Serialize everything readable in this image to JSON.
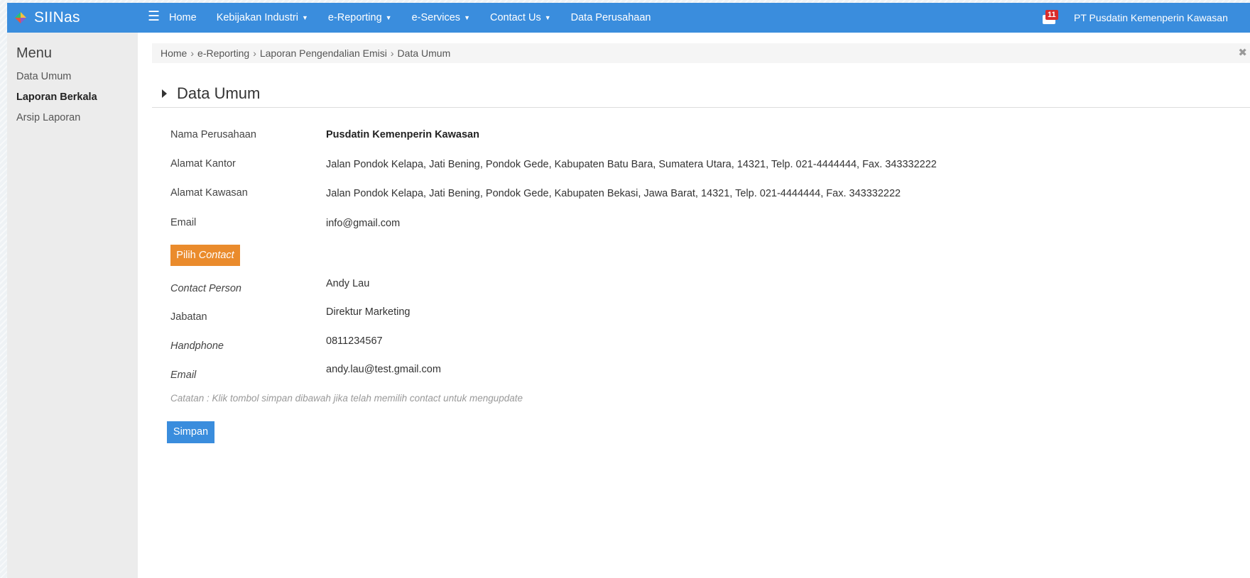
{
  "app": {
    "name": "SIINas",
    "logo_icon": "diamond-logo-icon"
  },
  "colors": {
    "primary": "#3a8ddd",
    "accent": "#ea8b2c",
    "badge": "#d92b2b"
  },
  "nav": {
    "home": "Home",
    "kebijakan": "Kebijakan Industri",
    "ereporting": "e-Reporting",
    "eservices": "e-Services",
    "contact": "Contact Us",
    "data_perusahaan": "Data Perusahaan"
  },
  "notifications": {
    "count": "11",
    "icon": "mail-icon"
  },
  "user": {
    "company": "PT Pusdatin Kemenperin Kawasan"
  },
  "sidebar": {
    "title": "Menu",
    "items": [
      {
        "label": "Data Umum"
      },
      {
        "label": "Laporan Berkala"
      },
      {
        "label": "Arsip Laporan"
      }
    ]
  },
  "breadcrumb": [
    "Home",
    "e-Reporting",
    "Laporan Pengendalian Emisi",
    "Data Umum"
  ],
  "page_title": "Data Umum",
  "fields": {
    "nama_label": "Nama Perusahaan",
    "nama_value": "Pusdatin Kemenperin Kawasan",
    "alamat_kantor_label": "Alamat Kantor",
    "alamat_kantor_value": "Jalan Pondok Kelapa, Jati Bening, Pondok Gede, Kabupaten Batu Bara, Sumatera Utara, 14321, Telp. 021-4444444, Fax. 343332222",
    "alamat_kawasan_label": "Alamat Kawasan",
    "alamat_kawasan_value": "Jalan Pondok Kelapa, Jati Bening, Pondok Gede, Kabupaten Bekasi, Jawa Barat, 14321, Telp. 021-4444444, Fax. 343332222",
    "email_label": "Email",
    "email_value": "info@gmail.com"
  },
  "contact_button": {
    "prefix": "Pilih",
    "emph": "Contact"
  },
  "contact": {
    "person_label": "Contact Person",
    "person_value": "Andy Lau",
    "jabatan_label": "Jabatan",
    "jabatan_value": "Direktur Marketing",
    "handphone_label": "Handphone",
    "handphone_value": "0811234567",
    "email_label": "Email",
    "email_value": "andy.lau@test.gmail.com"
  },
  "note": "Catatan : Klik tombol simpan dibawah jika telah memilih contact untuk mengupdate",
  "save_button": "Simpan"
}
